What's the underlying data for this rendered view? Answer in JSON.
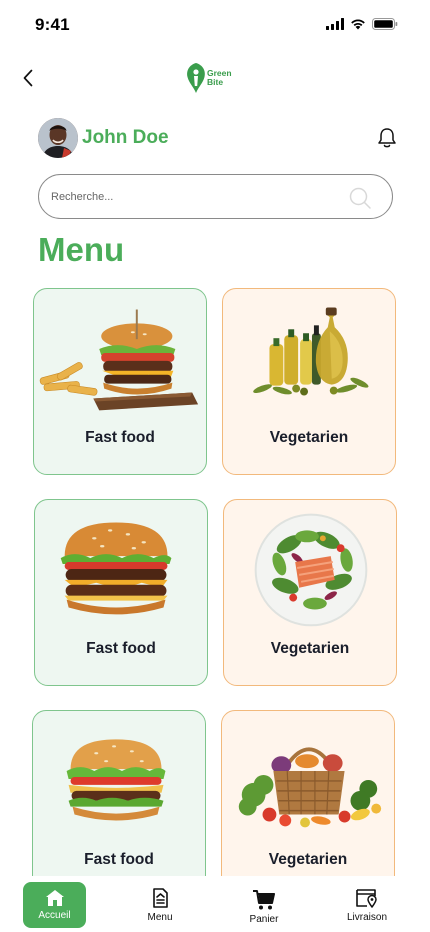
{
  "status_bar": {
    "time": "9:41"
  },
  "header": {
    "logo_line1": "Green",
    "logo_line2": "Bite"
  },
  "profile": {
    "name": "John Doe"
  },
  "search": {
    "placeholder": "Recherche..."
  },
  "page_title": "Menu",
  "categories": [
    {
      "label": "Fast food",
      "icon": "burger-fries-image",
      "style": "green"
    },
    {
      "label": "Vegetarien",
      "icon": "olive-oil-image",
      "style": "orange"
    },
    {
      "label": "Fast food",
      "icon": "double-burger-image",
      "style": "green"
    },
    {
      "label": "Vegetarien",
      "icon": "salmon-salad-image",
      "style": "orange"
    },
    {
      "label": "Fast food",
      "icon": "burger-image",
      "style": "green"
    },
    {
      "label": "Vegetarien",
      "icon": "vegetable-basket-image",
      "style": "orange"
    }
  ],
  "bottom_nav": {
    "items": [
      {
        "label": "Accueil",
        "icon": "home-icon",
        "active": true
      },
      {
        "label": "Menu",
        "icon": "menu-book-icon",
        "active": false
      },
      {
        "label": "Panier",
        "icon": "cart-icon",
        "active": false
      },
      {
        "label": "Livraison",
        "icon": "delivery-icon",
        "active": false
      }
    ]
  },
  "colors": {
    "brand_green": "#4bad5a",
    "card_green_bg": "#eef7f1",
    "card_orange_bg": "#fff5ec",
    "card_orange_border": "#f2b97c"
  }
}
